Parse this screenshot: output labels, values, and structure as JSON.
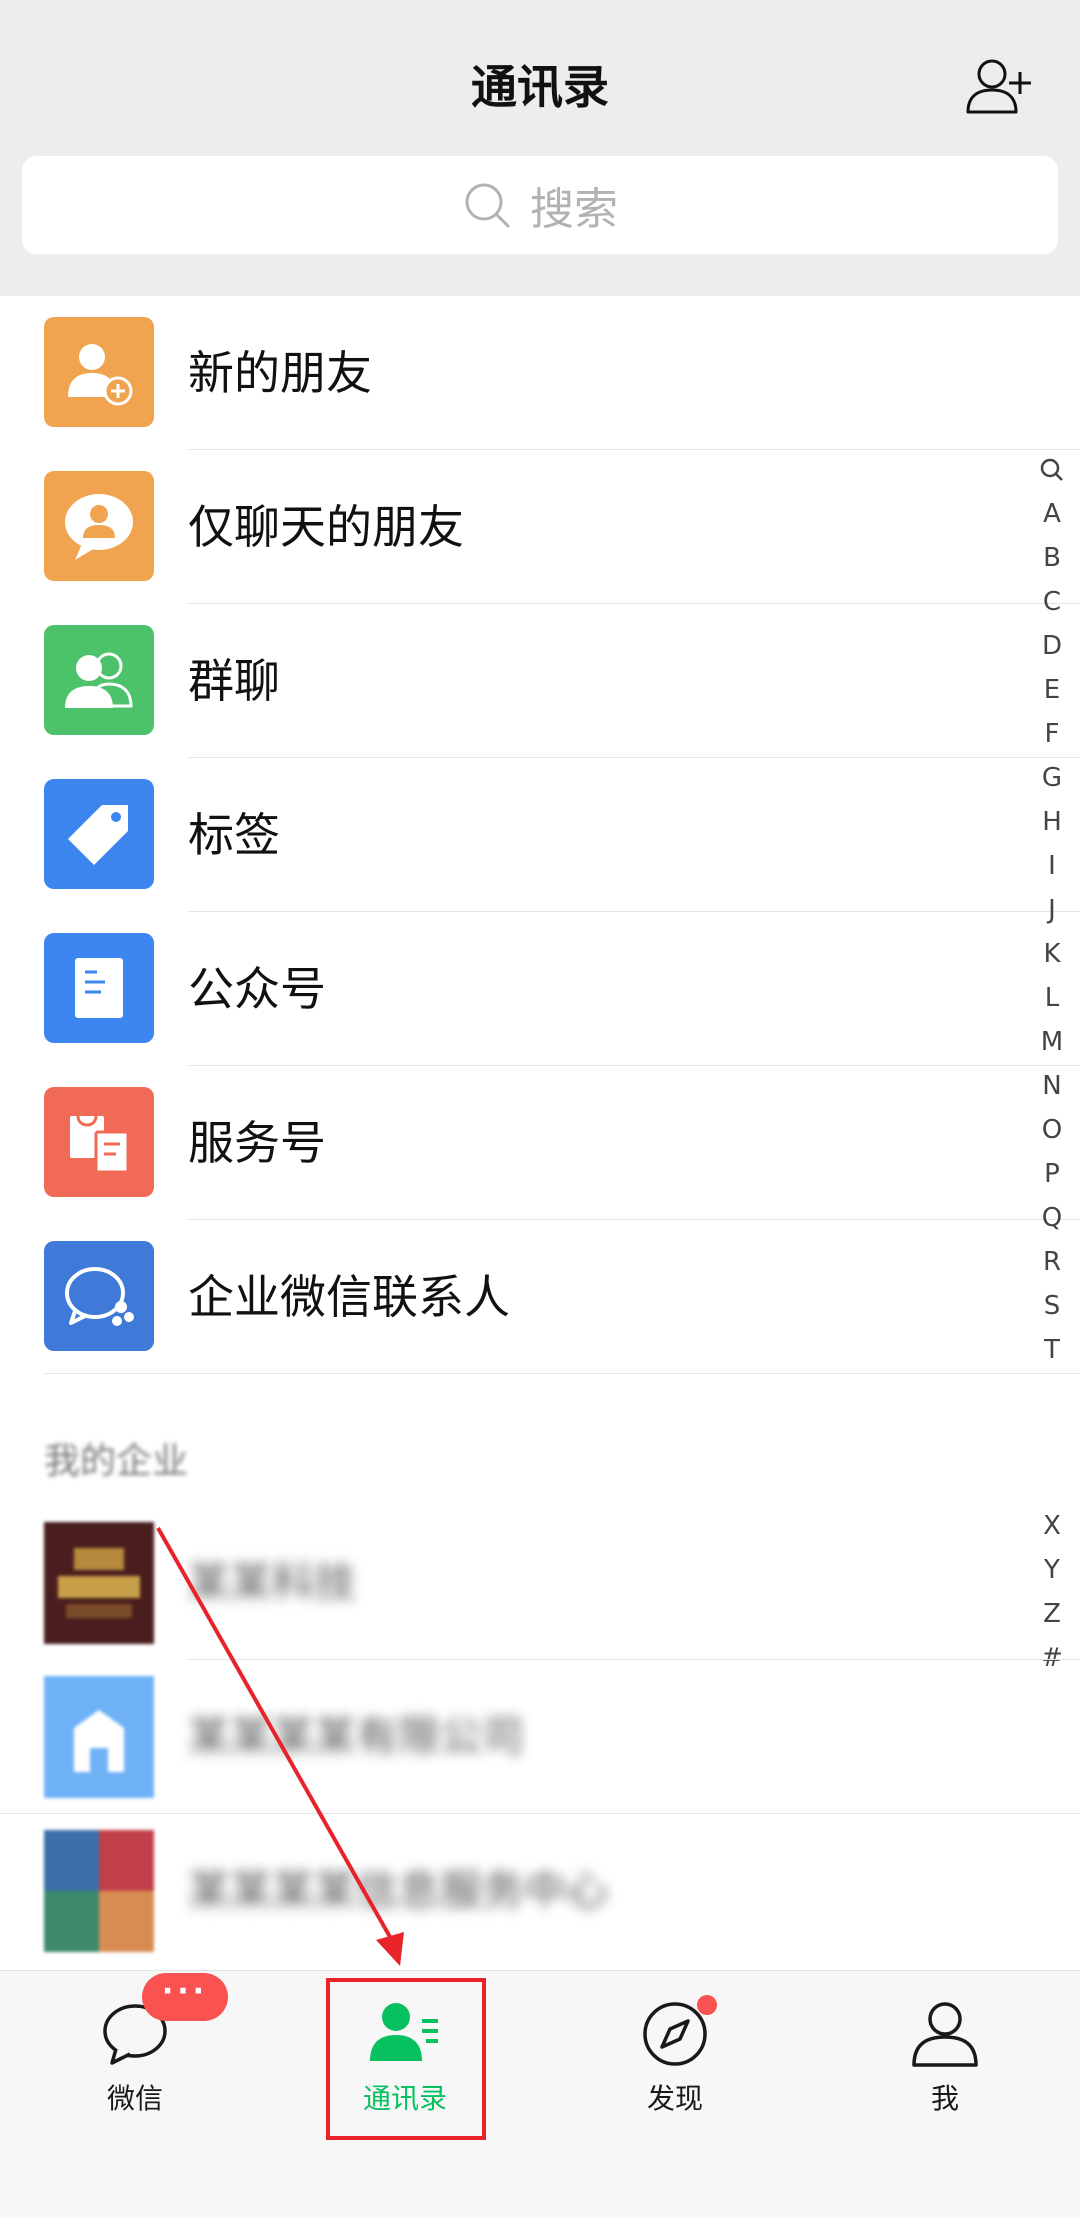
{
  "header": {
    "title": "通讯录",
    "search_placeholder": "搜索"
  },
  "function_items": [
    {
      "label": "新的朋友",
      "icon": "add-friend-icon",
      "color": "#f0a44f"
    },
    {
      "label": "仅聊天的朋友",
      "icon": "chat-only-friend-icon",
      "color": "#f0a44f"
    },
    {
      "label": "群聊",
      "icon": "group-chat-icon",
      "color": "#4cc36b"
    },
    {
      "label": "标签",
      "icon": "tag-icon",
      "color": "#3d86f0"
    },
    {
      "label": "公众号",
      "icon": "official-account-icon",
      "color": "#3d86f0"
    },
    {
      "label": "服务号",
      "icon": "service-account-icon",
      "color": "#f06a56"
    },
    {
      "label": "企业微信联系人",
      "icon": "wecom-contacts-icon",
      "color": "#3f7ad8"
    }
  ],
  "index_letters": [
    "A",
    "B",
    "C",
    "D",
    "E",
    "F",
    "G",
    "H",
    "I",
    "J",
    "K",
    "L",
    "M",
    "N",
    "O",
    "P",
    "Q",
    "R",
    "S",
    "T",
    "X",
    "Y",
    "Z",
    "#"
  ],
  "section": {
    "title": "我的企业",
    "items": [
      {
        "name": "某某科技"
      },
      {
        "name": "某某某某有限公司"
      },
      {
        "name": "某某某某信息服务中心"
      }
    ]
  },
  "tabbar": {
    "tabs": [
      {
        "label": "微信",
        "badge": "···"
      },
      {
        "label": "通讯录"
      },
      {
        "label": "发现"
      },
      {
        "label": "我"
      }
    ],
    "active_color": "#07c160",
    "badge_color": "#fa5151"
  },
  "annotation": {
    "highlight_color": "#e8242a"
  }
}
